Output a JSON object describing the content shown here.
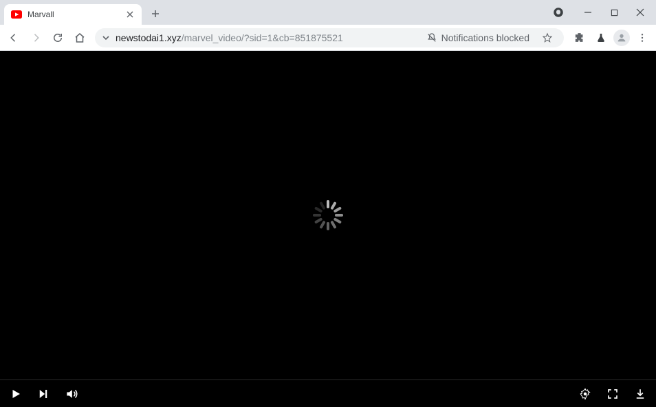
{
  "browser": {
    "tab": {
      "title": "Marvall",
      "favicon": "youtube"
    },
    "url": {
      "host": "newstodai1.xyz",
      "path": "/marvel_video/?sid=1&cb=851875521"
    },
    "notifications_label": "Notifications blocked"
  },
  "video": {
    "state": "loading"
  }
}
